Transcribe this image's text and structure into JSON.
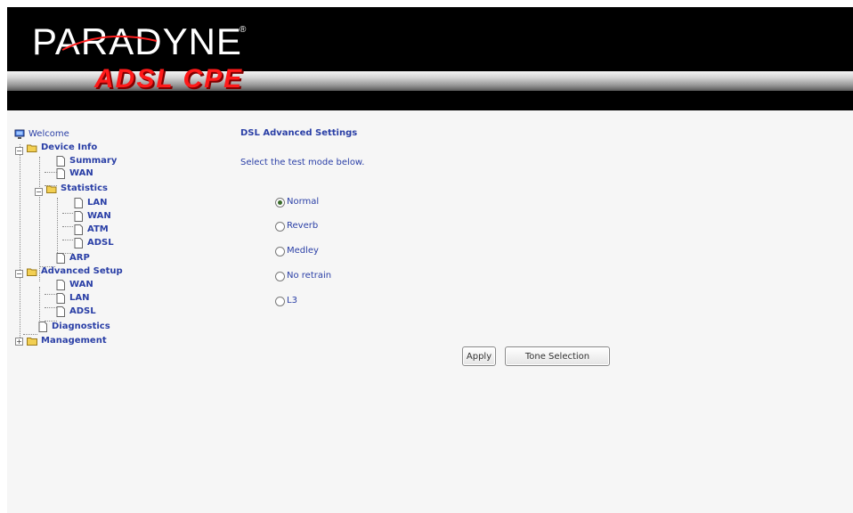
{
  "header": {
    "brand": "PARADYNE",
    "brand_mark": "®",
    "product": "ADSL CPE"
  },
  "nav": {
    "items": [
      {
        "label": "Welcome",
        "icon": "computer-icon"
      },
      {
        "label": "Device Info",
        "icon": "folder-open-icon"
      },
      {
        "label": "Summary",
        "icon": "page-icon"
      },
      {
        "label": "WAN",
        "icon": "page-icon"
      },
      {
        "label": "Statistics",
        "icon": "folder-open-icon"
      },
      {
        "label": "LAN",
        "icon": "page-icon"
      },
      {
        "label": "WAN",
        "icon": "page-icon"
      },
      {
        "label": "ATM",
        "icon": "page-icon"
      },
      {
        "label": "ADSL",
        "icon": "page-icon"
      },
      {
        "label": "ARP",
        "icon": "page-icon"
      },
      {
        "label": "Advanced Setup",
        "icon": "folder-open-icon"
      },
      {
        "label": "WAN",
        "icon": "page-icon"
      },
      {
        "label": "LAN",
        "icon": "page-icon"
      },
      {
        "label": "ADSL",
        "icon": "page-icon"
      },
      {
        "label": "Diagnostics",
        "icon": "page-icon"
      },
      {
        "label": "Management",
        "icon": "folder-closed-icon"
      }
    ]
  },
  "main": {
    "title": "DSL Advanced Settings",
    "instructions": "Select the test mode below.",
    "test_modes": [
      {
        "label": "Normal",
        "selected": true
      },
      {
        "label": "Reverb",
        "selected": false
      },
      {
        "label": "Medley",
        "selected": false
      },
      {
        "label": "No retrain",
        "selected": false
      },
      {
        "label": "L3",
        "selected": false
      }
    ],
    "apply_label": "Apply",
    "tone_selection_label": "Tone Selection"
  },
  "colors": {
    "link_blue": "#2a3fa6",
    "header_black": "#000000",
    "product_red": "#ff1a1a",
    "page_bg": "#f6f6f6"
  }
}
